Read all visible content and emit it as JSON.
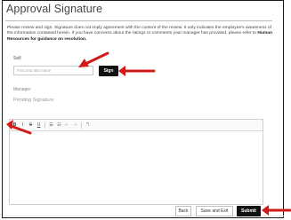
{
  "page": {
    "title": "Approval Signature",
    "description": "Please review and sign. Signature does not imply agreement with the content of the review. It only indicates the employee's awareness of the information contained herein. If you have concerns about the ratings or comments your manager has provided, please refer to ",
    "description_link": "Human Resources for guidance on resolution."
  },
  "self": {
    "label": "Self",
    "input_value": "",
    "input_placeholder": "First and last name",
    "sign_label": "Sign"
  },
  "manager": {
    "label": "Manager",
    "status": "Pending Signature"
  },
  "editor": {
    "toolbar": {
      "bold": "B",
      "italic": "I",
      "strike": "S",
      "underline": "U",
      "ordered_list": "☰",
      "bullet_list": "☷",
      "outdent": "⇤",
      "indent": "⇥",
      "clear": "ℸ"
    },
    "content": ""
  },
  "footer": {
    "back_label": "Back",
    "save_exit_label": "Save and Exit",
    "submit_label": "Submit"
  },
  "annotations": {
    "arrow_color": "#d11a1a"
  }
}
